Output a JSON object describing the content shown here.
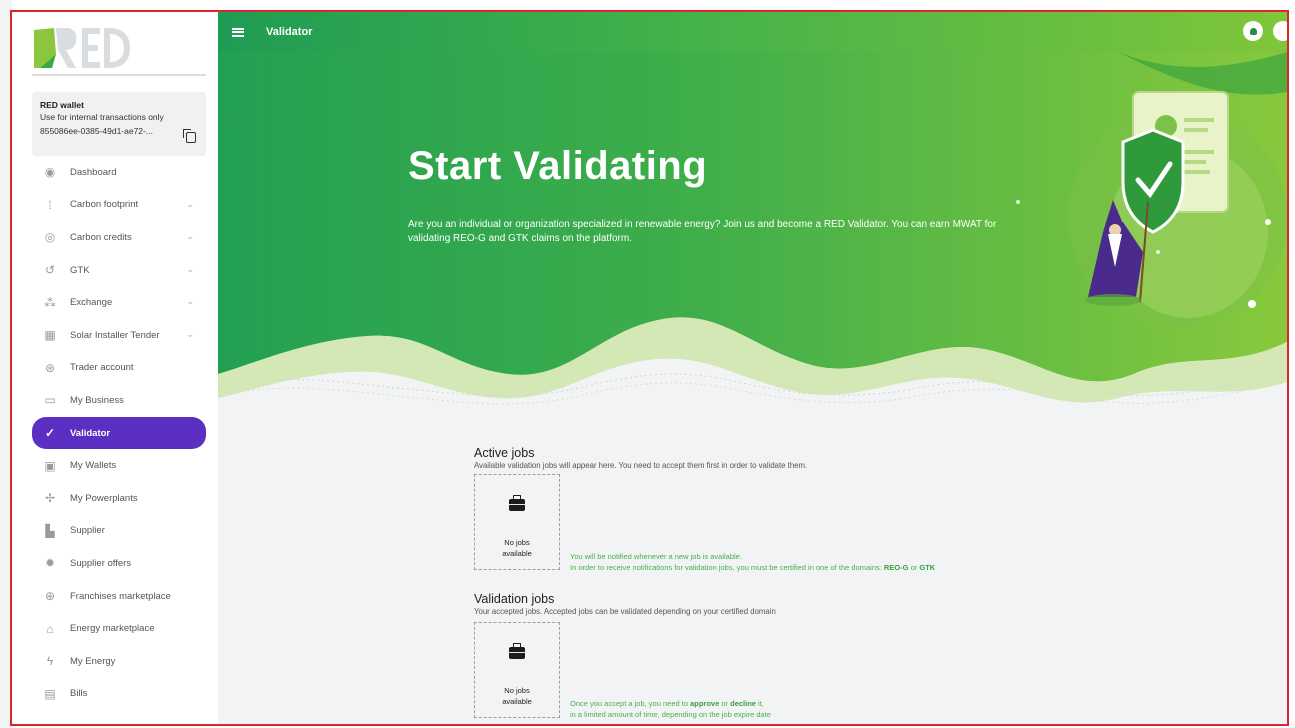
{
  "window": {
    "title": "Validator"
  },
  "brand": {
    "logo_text": "RED",
    "primary": "#5a2fc2",
    "green": "#46b04a"
  },
  "wallet": {
    "title": "RED wallet",
    "subtitle": "Use for internal transactions only",
    "id": "855086ee-0385-49d1-ae72-..."
  },
  "sidebar": {
    "items": [
      {
        "label": "Dashboard",
        "icon": "dashboard-icon",
        "has_chevron": false
      },
      {
        "label": "Carbon footprint",
        "icon": "footprint-icon",
        "has_chevron": true
      },
      {
        "label": "Carbon credits",
        "icon": "credits-icon",
        "has_chevron": true
      },
      {
        "label": "GTK",
        "icon": "gtk-icon",
        "has_chevron": true
      },
      {
        "label": "Exchange",
        "icon": "exchange-icon",
        "has_chevron": true
      },
      {
        "label": "Solar Installer Tender",
        "icon": "solar-panel-icon",
        "has_chevron": true
      },
      {
        "label": "Trader account",
        "icon": "trader-icon",
        "has_chevron": false
      },
      {
        "label": "My Business",
        "icon": "business-icon",
        "has_chevron": false
      },
      {
        "label": "Validator",
        "icon": "validator-icon",
        "has_chevron": false,
        "active": true
      },
      {
        "label": "My Wallets",
        "icon": "wallet-icon",
        "has_chevron": false
      },
      {
        "label": "My Powerplants",
        "icon": "powerplant-icon",
        "has_chevron": false
      },
      {
        "label": "Supplier",
        "icon": "truck-icon",
        "has_chevron": false
      },
      {
        "label": "Supplier offers",
        "icon": "offers-icon",
        "has_chevron": false
      },
      {
        "label": "Franchises marketplace",
        "icon": "globe-icon",
        "has_chevron": false
      },
      {
        "label": "Energy marketplace",
        "icon": "marketplace-icon",
        "has_chevron": false
      },
      {
        "label": "My Energy",
        "icon": "energy-icon",
        "has_chevron": false
      },
      {
        "label": "Bills",
        "icon": "bills-icon",
        "has_chevron": false
      }
    ]
  },
  "hero": {
    "title": "Start Validating",
    "description": "Are you an individual or organization specialized in renewable energy? Join us and become a RED Validator. You can earn MWAT for validating REO-G and GTK claims on the platform."
  },
  "active_jobs": {
    "title": "Active jobs",
    "subtitle": "Available validation jobs will appear here. You need to accept them first in order to validate them.",
    "empty_label": "No jobs available",
    "note_line1": "You will be notified whenever a new job is available.",
    "note_line2_prefix": "In order to receive notifications for validation jobs, you must be certified in one of the domains: ",
    "domain_a": "REO-G",
    "note_or": " or ",
    "domain_b": "GTK"
  },
  "validation_jobs": {
    "title": "Validation jobs",
    "subtitle": "Your accepted jobs. Accepted jobs can be validated depending on your certified domain",
    "empty_label": "No jobs available",
    "note_prefix": "Once you accept a job, you need to ",
    "note_approve": "approve",
    "note_or": " or ",
    "note_decline": "decline",
    "note_suffix": " it,",
    "note_line2": "in a limited amount of time, depending on the job expire date"
  }
}
